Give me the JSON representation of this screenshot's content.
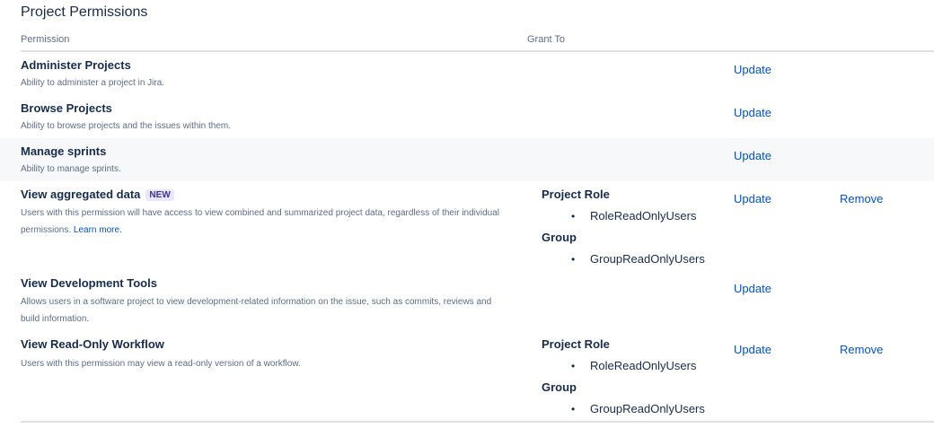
{
  "page": {
    "title": "Project Permissions"
  },
  "columns": {
    "permission": "Permission",
    "grant_to": "Grant To"
  },
  "permissions": [
    {
      "name": "Administer Projects",
      "desc": "Ability to administer a project in Jira.",
      "update": "Update"
    },
    {
      "name": "Browse Projects",
      "desc": "Ability to browse projects and the issues within them.",
      "update": "Update"
    },
    {
      "name": "Manage sprints",
      "desc": "Ability to manage sprints.",
      "update": "Update"
    },
    {
      "name": "View aggregated data",
      "badge": "NEW",
      "desc": "Users with this permission will have access to view combined and summarized project data, regardless of their individual permissions.",
      "learn_more": "Learn more.",
      "grants": [
        {
          "label": "Project Role",
          "item": "RoleReadOnlyUsers"
        },
        {
          "label": "Group",
          "item": "GroupReadOnlyUsers"
        }
      ],
      "update": "Update",
      "remove": "Remove"
    },
    {
      "name": "View Development Tools",
      "desc": "Allows users in a software project to view development-related information on the issue, such as commits, reviews and build information.",
      "update": "Update"
    },
    {
      "name": "View Read-Only Workflow",
      "desc": "Users with this permission may view a read-only version of a workflow.",
      "grants": [
        {
          "label": "Project Role",
          "item": "RoleReadOnlyUsers"
        },
        {
          "label": "Group",
          "item": "GroupReadOnlyUsers"
        }
      ],
      "update": "Update",
      "remove": "Remove"
    }
  ],
  "icons": {
    "bullet": "bullet-icon"
  },
  "colors": {
    "link": "#0052cc",
    "text": "#172b4d",
    "subtle": "#5e6c84",
    "badge_bg": "#eae6ff",
    "badge_fg": "#403294"
  }
}
